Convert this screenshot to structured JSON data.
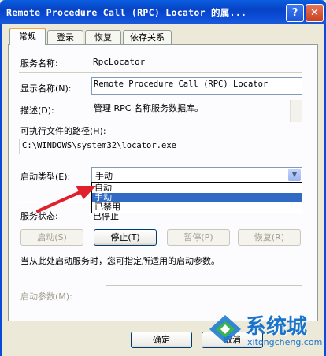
{
  "window": {
    "title": "Remote Procedure Call (RPC) Locator 的属...",
    "help_glyph": "?",
    "close_glyph": "✕"
  },
  "tabs": [
    "常规",
    "登录",
    "恢复",
    "依存关系"
  ],
  "general": {
    "service_name_label": "服务名称:",
    "service_name_value": "RpcLocator",
    "display_name_label": "显示名称(N):",
    "display_name_value": "Remote Procedure Call (RPC) Locator",
    "description_label": "描述(D):",
    "description_value": "管理 RPC 名称服务数据库。",
    "exe_path_label": "可执行文件的路径(H):",
    "exe_path_value": "C:\\WINDOWS\\system32\\locator.exe",
    "startup_type_label": "启动类型(E):",
    "startup_type_value": "手动",
    "startup_options": [
      "自动",
      "手动",
      "已禁用"
    ],
    "startup_selected_index": 1,
    "service_status_label": "服务状态:",
    "service_status_value": "已停止",
    "buttons": {
      "start": "启动(S)",
      "stop": "停止(T)",
      "pause": "暂停(P)",
      "resume": "恢复(R)"
    },
    "hint": "当从此处启动服务时，您可指定所适用的启动参数。",
    "start_params_label": "启动参数(M):",
    "start_params_value": ""
  },
  "footer": {
    "ok": "确定",
    "cancel": "取消"
  },
  "annotation": {
    "color": "#e0202a"
  },
  "watermark": {
    "brand": "系统城",
    "url": "xitongcheng.com"
  }
}
